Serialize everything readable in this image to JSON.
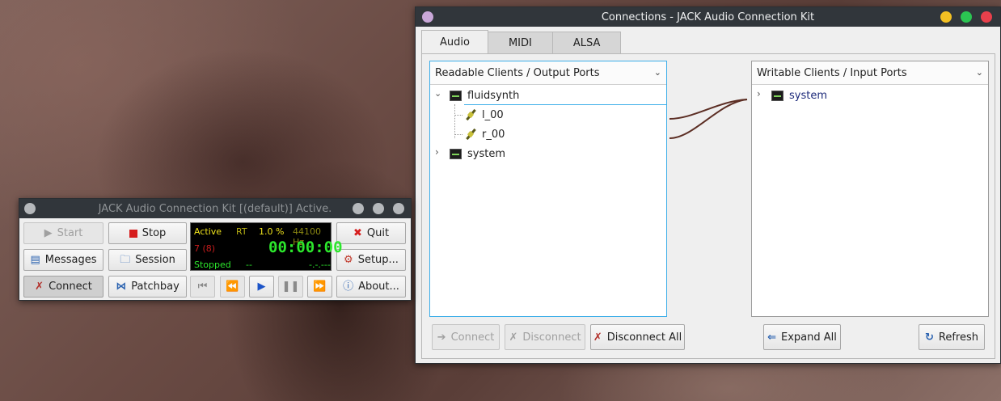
{
  "connections_window": {
    "title": "Connections - JACK Audio Connection Kit",
    "tabs": [
      {
        "label": "Audio",
        "active": true
      },
      {
        "label": "MIDI",
        "active": false
      },
      {
        "label": "ALSA",
        "active": false
      }
    ],
    "readable": {
      "header": "Readable Clients / Output Ports",
      "clients": [
        {
          "name": "fluidsynth",
          "expanded": true,
          "ports": [
            "l_00",
            "r_00"
          ]
        },
        {
          "name": "system",
          "expanded": false,
          "ports": []
        }
      ]
    },
    "writable": {
      "header": "Writable Clients / Input Ports",
      "clients": [
        {
          "name": "system",
          "expanded": false
        }
      ]
    },
    "buttons": {
      "connect": "Connect",
      "disconnect": "Disconnect",
      "disconnect_all": "Disconnect All",
      "expand_all": "Expand All",
      "refresh": "Refresh"
    },
    "wire_color": "#5c2e24",
    "accent": "#3daee9"
  },
  "jack_window": {
    "title": "JACK Audio Connection Kit [(default)] Active.",
    "buttons": {
      "start": "Start",
      "stop": "Stop",
      "quit": "Quit",
      "messages": "Messages",
      "session": "Session",
      "setup": "Setup...",
      "connect": "Connect",
      "patchbay": "Patchbay",
      "about": "About..."
    },
    "display": {
      "status": "Active",
      "rt": "RT",
      "dsp_load": "1.0 %",
      "sample_rate": "44100 Hz",
      "xruns": "7 (8)",
      "time": "00:00:00",
      "transport": "Stopped",
      "transport_extra": "--",
      "bbt": "-.-.---"
    }
  }
}
